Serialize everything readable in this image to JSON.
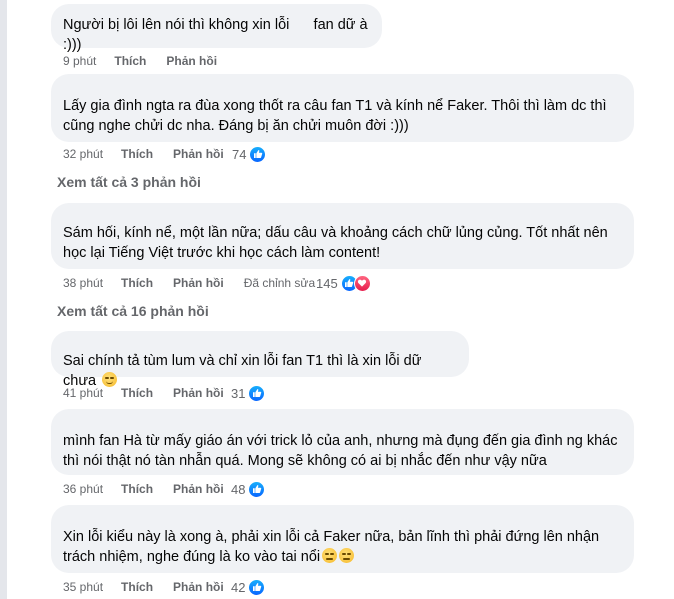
{
  "comments": [
    {
      "text": "Người bị lôi lên nói thì không xin lỗi      fan dữ à :)))",
      "time": "9 phút",
      "like_label": "Thích",
      "reply_label": "Phản hồi",
      "reaction_count": "",
      "reactions": []
    },
    {
      "text": "Lấy gia đình ngta ra đùa xong thốt ra câu fan T1 và kính nể Faker. Thôi thì làm dc thì cũng nghe chửi dc nha. Đáng bị ăn chửi muôn đời :)))",
      "time": "32 phút",
      "like_label": "Thích",
      "reply_label": "Phản hồi",
      "reaction_count": "74",
      "reactions": [
        "like-icon"
      ]
    },
    {
      "text": "Sám hối, kính nể, một lần nữa; dấu câu và khoảng cách chữ lủng củng. Tốt nhất nên học lại Tiếng Việt trước khi học cách làm content!",
      "time": "38 phút",
      "like_label": "Thích",
      "reply_label": "Phản hồi",
      "edited_label": "Đã chỉnh sửa",
      "reaction_count": "145",
      "reactions": [
        "like-icon",
        "love-icon"
      ]
    },
    {
      "text": "Sai chính tả tùm lum và chỉ xin lỗi fan T1 thì là xin lỗi dữ chưa",
      "time": "41 phút",
      "like_label": "Thích",
      "reply_label": "Phản hồi",
      "reaction_count": "31",
      "reactions": [
        "like-icon"
      ]
    },
    {
      "text": "mình fan Hà từ mấy giáo án với trick lỏ của anh, nhưng mà đụng đến gia đình ng khác thì nói thật nó tàn nhẫn quá. Mong sẽ không có ai bị nhắc đến như vậy nữa",
      "time": "36 phút",
      "like_label": "Thích",
      "reply_label": "Phản hồi",
      "reaction_count": "48",
      "reactions": [
        "like-icon"
      ]
    },
    {
      "text": "Xin lỗi kiểu này là xong à, phải xin lỗi cả Faker nữa, bản lĩnh thì phải đứng lên nhận trách nhiệm, nghe đúng là ko vào tai nổi",
      "time": "35 phút",
      "like_label": "Thích",
      "reply_label": "Phản hồi",
      "reaction_count": "42",
      "reactions": [
        "like-icon"
      ]
    }
  ],
  "view_replies": [
    "Xem tất cả 3 phản hồi",
    "Xem tất cả 16 phản hồi"
  ],
  "colors": {
    "bubble": "#f0f2f5",
    "meta_text": "#65676b",
    "like_blue": "#0866ff",
    "love_red": "#e61e4d"
  }
}
